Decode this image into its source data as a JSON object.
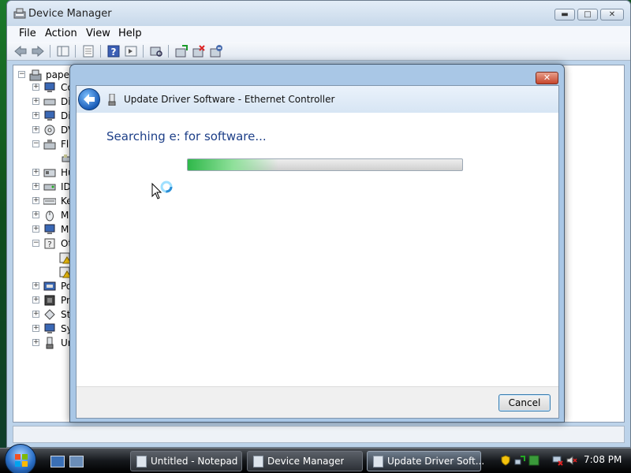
{
  "window": {
    "title": "Device Manager",
    "minimize": "▬",
    "maximize": "□",
    "close": "✕"
  },
  "menu": {
    "file": "File",
    "action": "Action",
    "view": "View",
    "help": "Help"
  },
  "tree": {
    "root": "paper",
    "items": [
      "Co",
      "Di",
      "Di",
      "DV",
      "Fl",
      "",
      "Hu",
      "ID",
      "Ke",
      "M",
      "M",
      "Ot",
      "",
      "",
      "Po",
      "Pr",
      "St",
      "Sy",
      "Ur"
    ]
  },
  "dialog": {
    "title": "Update Driver Software - Ethernet Controller",
    "status_text": "Searching e: for software...",
    "progress_fraction": 0.33,
    "cancel_label": "Cancel",
    "close": "✕"
  },
  "taskbar": {
    "tasks": [
      "Untitled - Notepad",
      "Device Manager",
      "Update Driver Soft..."
    ],
    "clock": "7:08 PM"
  },
  "colors": {
    "accent": "#1d3f88",
    "progress": "#2fb84a"
  }
}
